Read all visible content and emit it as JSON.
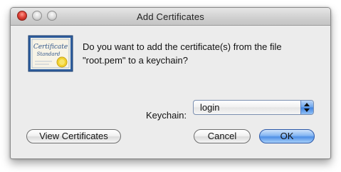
{
  "window": {
    "title": "Add Certificates"
  },
  "icon": {
    "name": "certificate-icon",
    "caption_line1": "Certificate",
    "caption_line2": "Standard"
  },
  "message": {
    "line1": "Do you want to add the certificate(s) from the file",
    "line2": "\"root.pem\" to a keychain?"
  },
  "keychain": {
    "label": "Keychain:",
    "selected": "login"
  },
  "buttons": {
    "view_certificates": "View Certificates",
    "cancel": "Cancel",
    "ok": "OK"
  },
  "colors": {
    "accent": "#4f8fe6",
    "close": "#e0443a"
  }
}
